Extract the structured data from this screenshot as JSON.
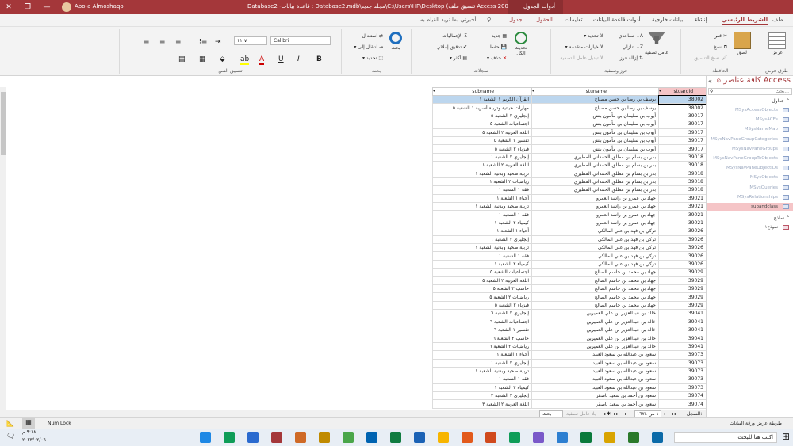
{
  "titlebar": {
    "user": "Abo-a Almoshaqo",
    "title": "Access  (Access 2000 تنسيق ملف) C:\\Users\\HP\\Desktop\\مجلد جديد\\Database2.mdb : قاعدة بيانات- Database2",
    "context_tab": "أدوات الجدول"
  },
  "tabs": [
    "ملف",
    "الشريط الرئيسي",
    "إنشاء",
    "بيانات خارجية",
    "أدوات قاعدة البيانات",
    "تعليمات",
    "الحقول",
    "جدول"
  ],
  "tell_me": "أخبرني بما تريد القيام به",
  "ribbon": {
    "groups": [
      "طرق عرض",
      "الحافظة",
      "فرز وتصفية",
      "سجلات",
      "بحث",
      "تنسيق النص"
    ],
    "view": "عرض",
    "paste": "لصق",
    "cut": "قص",
    "copy": "نسخ",
    "format_painter": "نسخ التنسيق",
    "filter": "عامل تصفية",
    "ascending": "تصاعدي",
    "descending": "تنازلي",
    "remove_sort": "إزالة فرز",
    "selection": "تحديد",
    "advanced": "خيارات متقدمة",
    "toggle_filter": "تبديل عامل التصفية",
    "refresh_all": "تحديث الكل",
    "new": "جديد",
    "save": "حفظ",
    "delete": "حذف",
    "totals": "الإجماليات",
    "spelling": "تدقيق إملائي",
    "more": "أكثر",
    "find": "بحث",
    "replace": "استبدال",
    "goto": "انتقال إلى",
    "select": "تحديد",
    "font_name": "Calibri",
    "font_size": "١١"
  },
  "table": {
    "name": "subandclass",
    "columns": [
      "subname",
      "stuname",
      "stuardid"
    ],
    "rows": [
      [
        "القرآن الكريم ١ الشعبة ١",
        "يوسف بن رضا بن حسن مصباح",
        "38002"
      ],
      [
        "مهارات حياتية وتربية أسرية ١ الشعبة ٥",
        "يوسف بن رضا بن حسن مصباح",
        "38002"
      ],
      [
        "إنجليزي ٢ الشعبة ٥",
        "أيوب بن سليمان بن مأمون بنش",
        "39017"
      ],
      [
        "اجتماعيات الشعبة ٥",
        "أيوب بن سليمان بن مأمون بنش",
        "39017"
      ],
      [
        "اللغة العربية ٢ الشعبة ٥",
        "أيوب بن سليمان بن مأمون بنش",
        "39017"
      ],
      [
        "تفسير ١ الشعبة ٥",
        "أيوب بن سليمان بن مأمون بنش",
        "39017"
      ],
      [
        "فيزياء ٢ الشعبة ٥",
        "أيوب بن سليمان بن مأمون بنش",
        "39017"
      ],
      [
        "إنجليزي ٢ الشعبة ١",
        "بدر بن بسام بن مطلق الحمداني المطيري",
        "39018"
      ],
      [
        "اللغة العربية ٢ الشعبة ١",
        "بدر بن بسام بن مطلق الحمداني المطيري",
        "39018"
      ],
      [
        "تربية صحية وبدنية الشعبة ١",
        "بدر بن بسام بن مطلق الحمداني المطيري",
        "39018"
      ],
      [
        "رياضيات ٢ الشعبة ١",
        "بدر بن بسام بن مطلق الحمداني المطيري",
        "39018"
      ],
      [
        "فقه ١ الشعبة ١",
        "بدر بن بسام بن مطلق الحمداني المطيري",
        "39018"
      ],
      [
        "أحياء ١ الشعبة ١",
        "جهاد بن عمرو بن راشد العمرو",
        "39021"
      ],
      [
        "تربية صحية وبدنية الشعبة ١",
        "جهاد بن عمرو بن راشد العمرو",
        "39021"
      ],
      [
        "فقه ١ الشعبة ١",
        "جهاد بن عمرو بن راشد العمرو",
        "39021"
      ],
      [
        "كيمياء ٢ الشعبة ١",
        "جهاد بن عمرو بن راشد العمرو",
        "39021"
      ],
      [
        "أحياء ١ الشعبة ١",
        "تركي بن فهد بن علي المالكي",
        "39026"
      ],
      [
        "إنجليزي ٢ الشعبة ١",
        "تركي بن فهد بن علي المالكي",
        "39026"
      ],
      [
        "تربية صحية وبدنية الشعبة ١",
        "تركي بن فهد بن علي المالكي",
        "39026"
      ],
      [
        "فقه ١ الشعبة ١",
        "تركي بن فهد بن علي المالكي",
        "39026"
      ],
      [
        "كيمياء ٢ الشعبة ١",
        "تركي بن فهد بن علي المالكي",
        "39026"
      ],
      [
        "اجتماعيات الشعبة ٥",
        "جهاد بن محمد بن جاسم الصالح",
        "39029"
      ],
      [
        "اللغة العربية ٢ الشعبة ٥",
        "جهاد بن محمد بن جاسم الصالح",
        "39029"
      ],
      [
        "حاسب ٢ الشعبة ٥",
        "جهاد بن محمد بن جاسم الصالح",
        "39029"
      ],
      [
        "رياضيات ٢ الشعبة ٥",
        "جهاد بن محمد بن جاسم الصالح",
        "39029"
      ],
      [
        "فيزياء ٢ الشعبة ٥",
        "جهاد بن محمد بن جاسم الصالح",
        "39029"
      ],
      [
        "إنجليزي ٢ الشعبة ٦",
        "خالد بن عبدالعزيز بن علي العميرين",
        "39041"
      ],
      [
        "اجتماعيات الشعبة ٦",
        "خالد بن عبدالعزيز بن علي العميرين",
        "39041"
      ],
      [
        "تفسير ١ الشعبة ٦",
        "خالد بن عبدالعزيز بن علي العميرين",
        "39041"
      ],
      [
        "حاسب ٢ الشعبة ٦",
        "خالد بن عبدالعزيز بن علي العميرين",
        "39041"
      ],
      [
        "رياضيات ٢ الشعبة ٦",
        "خالد بن عبدالعزيز بن علي العميرين",
        "39041"
      ],
      [
        "أحياء ١ الشعبة ١",
        "سعود بن عبدالله بن سعود العبيد",
        "39073"
      ],
      [
        "إنجليزي ٢ الشعبة ١",
        "سعود بن عبدالله بن سعود العبيد",
        "39073"
      ],
      [
        "تربية صحية وبدنية الشعبة ١",
        "سعود بن عبدالله بن سعود العبيد",
        "39073"
      ],
      [
        "فقه ١ الشعبة ١",
        "سعود بن عبدالله بن سعود العبيد",
        "39073"
      ],
      [
        "كيمياء ٢ الشعبة ١",
        "سعود بن عبدالله بن سعود العبيد",
        "39073"
      ],
      [
        "إنجليزي ٢ الشعبة ٣",
        "سعود بن أحمد بن سعيد باصقر",
        "39074"
      ],
      [
        "اللغة العربية ٢ الشعبة ٣",
        "سعود بن أحمد بن سعيد باصقر",
        "39074"
      ]
    ]
  },
  "record_nav": {
    "label": "السجل:",
    "position": "١ من ١٦٧٤",
    "filter": "بلا عامل تصفية",
    "search": "بحث"
  },
  "nav": {
    "title": "كافة عناصر Access",
    "search": "بحث...",
    "section_tables": "جداول",
    "tables": [
      "MSysAccessObjects",
      "MSysACEs",
      "MSysNameMap",
      "MSysNavPaneGroupCategories",
      "MSysNavPaneGroups",
      "MSysNavPaneGroupToObjects",
      "MSysNavPaneObjectIDs",
      "MSysObjects",
      "MSysQueries",
      "MSysRelationships",
      "subandclass"
    ],
    "active": "subandclass",
    "section_forms": "نماذج",
    "forms": [
      "نموذج١"
    ]
  },
  "statusbar": {
    "left": "طريقة عرض ورقة البيانات",
    "numlock": "Num Lock"
  },
  "taskbar": {
    "search": "اكتب هنا للبحث",
    "time": "٩:١٨ م",
    "date": "٢٠٢٣/٠٢/٠٦"
  },
  "colors": {
    "accent": "#a4373a",
    "selection": "#bcd6ee",
    "nav_active": "#f5c5c7"
  }
}
